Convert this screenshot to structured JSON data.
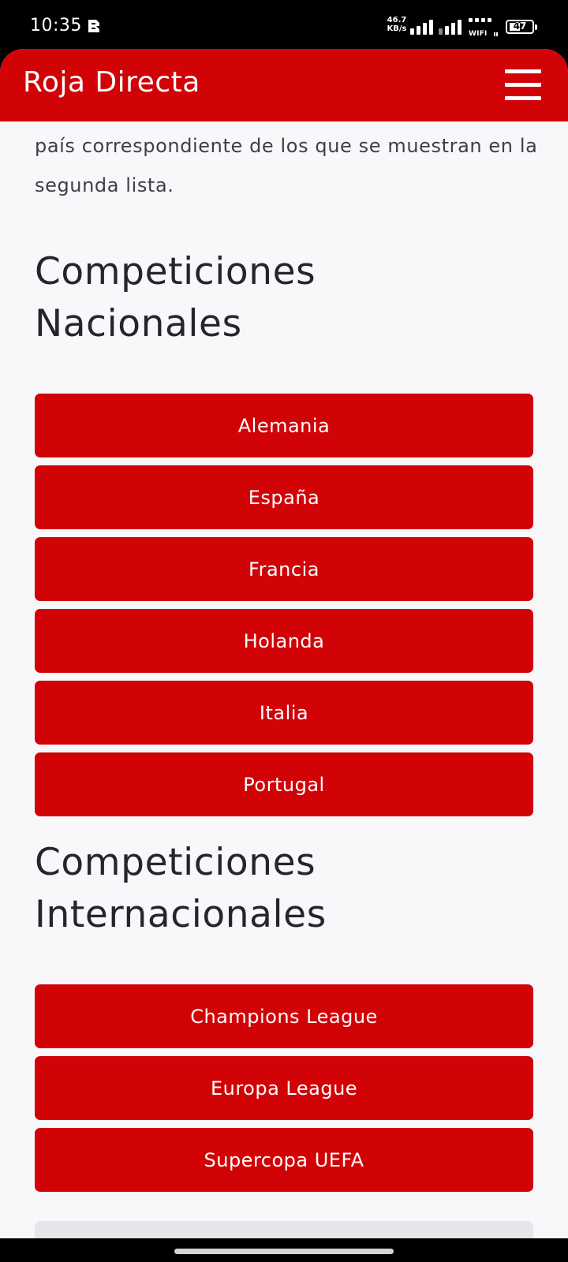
{
  "status_bar": {
    "time": "10:35",
    "net_speed_value": "46.7",
    "net_speed_unit": "KB/s",
    "wifi_label": "WIFI",
    "battery": "47",
    "battery_level": 0.47
  },
  "header": {
    "brand": "Roja Directa",
    "menu_icon": "hamburger-menu-icon"
  },
  "intro_text": "país correspondiente de los que se muestran en la segunda lista.",
  "national": {
    "title_line1": "Competiciones",
    "title_line2": "Nacionales",
    "items": [
      {
        "label": "Alemania"
      },
      {
        "label": "España"
      },
      {
        "label": "Francia"
      },
      {
        "label": "Holanda"
      },
      {
        "label": "Italia"
      },
      {
        "label": "Portugal"
      }
    ]
  },
  "international": {
    "title_line1": "Competiciones",
    "title_line2": "Internacionales",
    "items": [
      {
        "label": "Champions League"
      },
      {
        "label": "Europa League"
      },
      {
        "label": "Supercopa UEFA"
      }
    ]
  },
  "colors": {
    "brand_red": "#d10307",
    "page_background": "#f8f7f9",
    "heading_text": "#23262b",
    "body_text": "#3c4046"
  }
}
